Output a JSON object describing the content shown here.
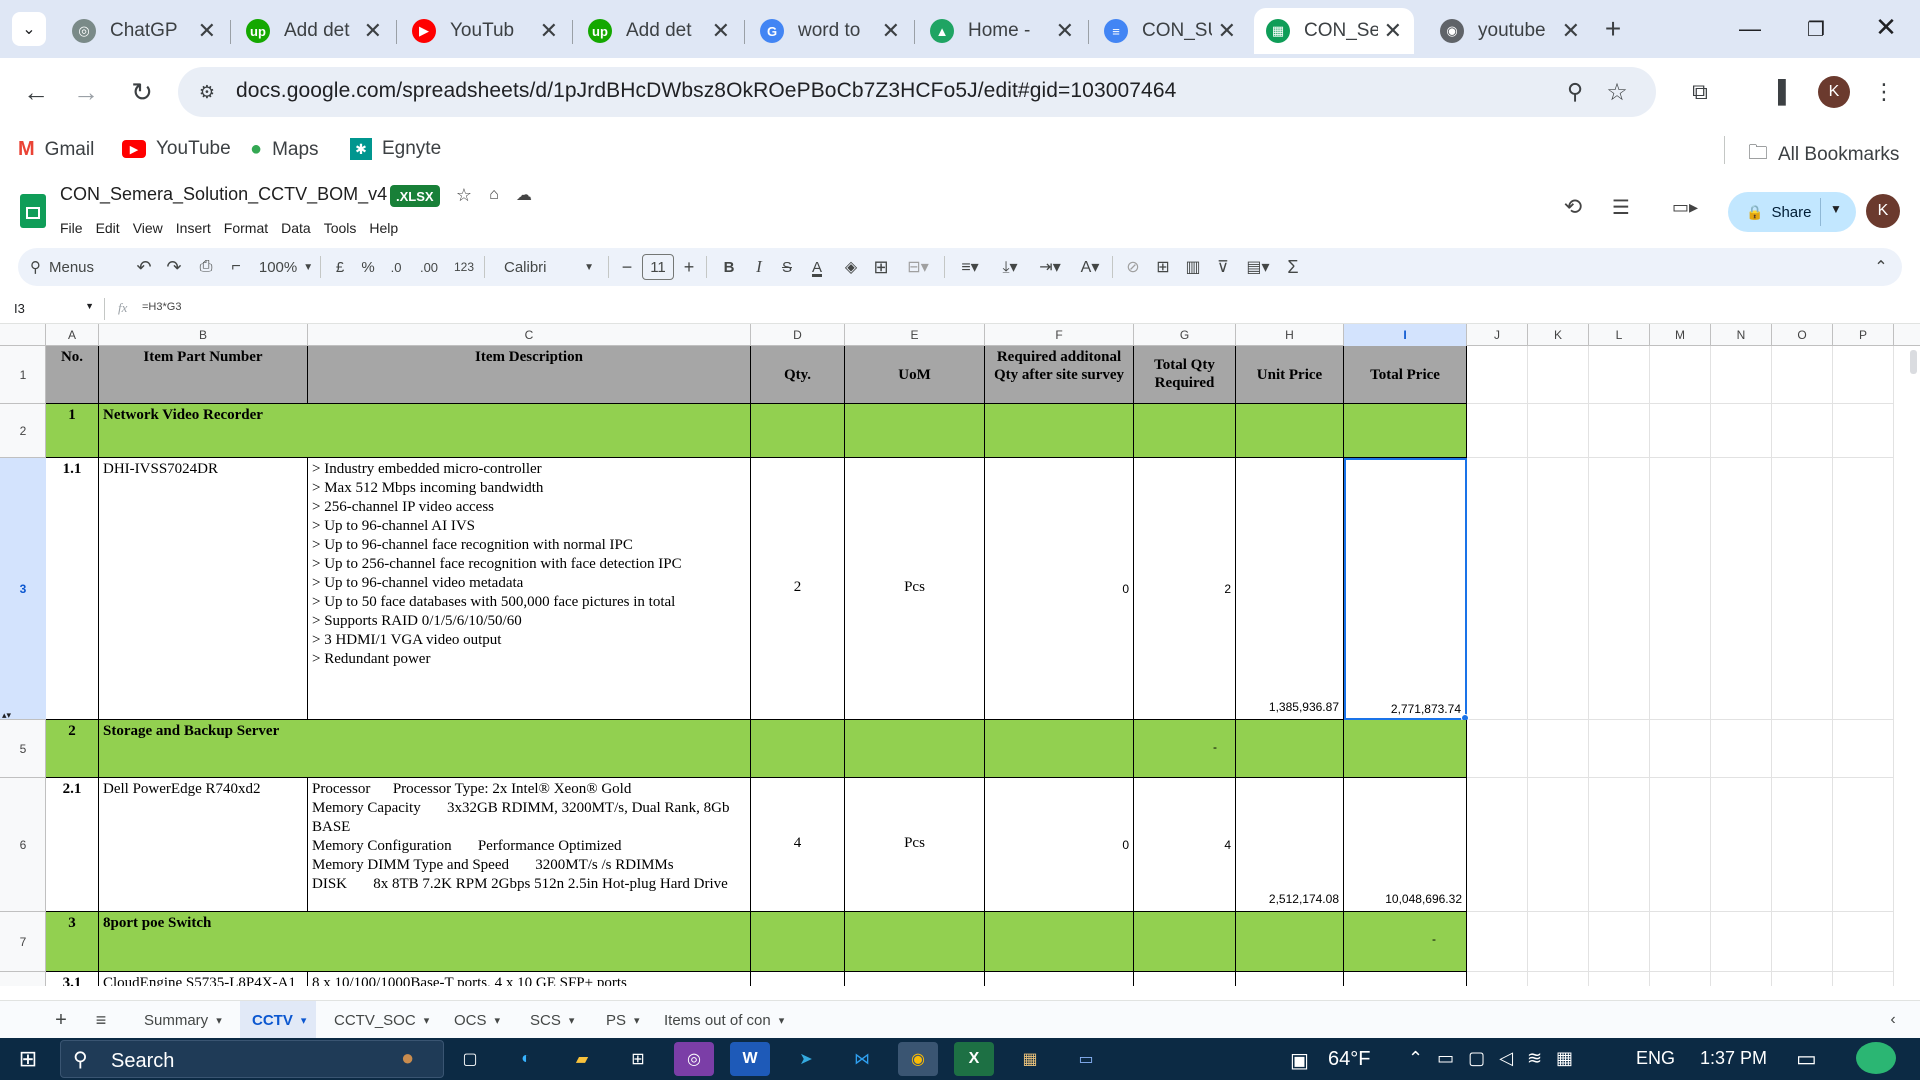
{
  "browser": {
    "tabs": [
      {
        "title": "ChatGP",
        "color": "#7a8a88",
        "glyph": "◎"
      },
      {
        "title": "Add det",
        "color": "#14a800",
        "glyph": "up"
      },
      {
        "title": "YouTub",
        "color": "#ff0000",
        "glyph": "▶"
      },
      {
        "title": "Add det",
        "color": "#14a800",
        "glyph": "up"
      },
      {
        "title": "word to",
        "color": "#4285f4",
        "glyph": "G"
      },
      {
        "title": "Home -",
        "color": "#1fa463",
        "glyph": "▲"
      },
      {
        "title": "CON_SU",
        "color": "#4285f4",
        "glyph": "≡"
      },
      {
        "title": "CON_Se",
        "color": "#0f9d58",
        "glyph": "▦"
      },
      {
        "title": "youtube",
        "color": "#5f6368",
        "glyph": "◉"
      }
    ],
    "url": "docs.google.com/spreadsheets/d/1pJrdBHcDWbsz8OkROePBoCb7Z3HCFo5J/edit#gid=103007464",
    "profile_initial": "K",
    "bookmarks": [
      "Gmail",
      "YouTube",
      "Maps",
      "Egnyte"
    ],
    "all_bookmarks": "All Bookmarks"
  },
  "doc": {
    "title": "CON_Semera_Solution_CCTV_BOM_v4",
    "badge": ".XLSX",
    "menus": [
      "File",
      "Edit",
      "View",
      "Insert",
      "Format",
      "Data",
      "Tools",
      "Help"
    ],
    "share": "Share",
    "initial": "K"
  },
  "toolbar": {
    "menus": "Menus",
    "zoom": "100%",
    "currency": "£",
    "percent": "%",
    "dec_minus": ".0",
    "dec_plus": ".00",
    "numfmt": "123",
    "font": "Calibri",
    "font_size": "11"
  },
  "formula": {
    "cellref": "I3",
    "formula": "=H3*G3"
  },
  "columns": [
    "A",
    "B",
    "C",
    "D",
    "E",
    "F",
    "G",
    "H",
    "I",
    "J",
    "K",
    "L",
    "M",
    "N",
    "O",
    "P"
  ],
  "rows": [
    "1",
    "2",
    "3",
    "5",
    "6",
    "7",
    ""
  ],
  "table": {
    "headers": {
      "no": "No.",
      "part": "Item Part Number",
      "desc": "Item Description",
      "qty": "Qty.",
      "uom": "UoM",
      "add": "Required additonal  Qty after site survey",
      "total_qty": "Total Qty Required",
      "unit": "Unit Price",
      "total": "Total Price"
    },
    "sec1": {
      "no": "1",
      "title": "Network Video Recorder"
    },
    "item11": {
      "no": "1.1",
      "part": "DHI-IVSS7024DR",
      "desc": "> Industry embedded micro-controller\n> Max 512 Mbps incoming bandwidth\n> 256-channel IP video access\n> Up to 96-channel AI IVS\n> Up to 96-channel face recognition with normal IPC\n> Up to 256-channel face recognition with face detection IPC\n> Up to 96-channel video metadata\n> Up to 50 face databases with 500,000 face pictures in total\n> Supports RAID 0/1/5/6/10/50/60\n> 3 HDMI/1 VGA video output\n> Redundant power",
      "qty": "2",
      "uom": "Pcs",
      "add": "0",
      "total_qty": "2",
      "unit": "1,385,936.87",
      "total": "2,771,873.74"
    },
    "sec2": {
      "no": "2",
      "title": "Storage and Backup Server",
      "dash": "-"
    },
    "item21": {
      "no": "2.1",
      "part": "Dell PowerEdge R740xd2",
      "desc": "Processor      Processor Type: 2x Intel® Xeon® Gold\nMemory Capacity       3x32GB RDIMM, 3200MT/s, Dual Rank, 8Gb BASE\nMemory Configuration       Performance Optimized\nMemory DIMM Type and Speed       3200MT/s /s RDIMMs\nDISK       8x 8TB 7.2K RPM 2Gbps 512n 2.5in Hot-plug Hard Drive",
      "qty": "4",
      "uom": "Pcs",
      "add": "0",
      "total_qty": "4",
      "unit": "2,512,174.08",
      "total": "10,048,696.32"
    },
    "sec3": {
      "no": "3",
      "title": "8port poe Switch",
      "dash": "-"
    },
    "item31": {
      "no": "3.1",
      "part": "CloudEngine S5735-L8P4X-A1",
      "desc": "8 x 10/100/1000Base-T ports, 4 x 10 GE SFP+ ports"
    }
  },
  "sheets": [
    "Summary",
    "CCTV",
    "CCTV_SOC",
    "OCS",
    "SCS",
    "PS",
    "Items out of con"
  ],
  "active_sheet": "CCTV",
  "taskbar": {
    "search": "Search",
    "weather": "64°F",
    "lang": "ENG",
    "time": "1:37 PM"
  }
}
